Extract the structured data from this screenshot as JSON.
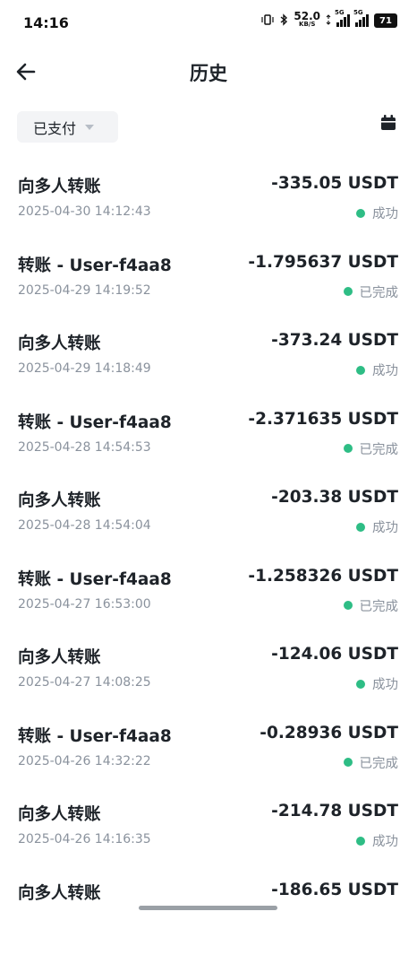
{
  "status_bar": {
    "time": "14:16",
    "net_speed": "52.0",
    "net_unit": "KB/S",
    "signal1_tag": "5G",
    "signal2_tag": "5G",
    "battery": "71"
  },
  "header": {
    "title": "历史"
  },
  "filter": {
    "label": "已支付"
  },
  "transactions": [
    {
      "name": "向多人转账",
      "amount": "-335.05 USDT",
      "date": "2025-04-30 14:12:43",
      "status": "成功"
    },
    {
      "name": "转账 - User-f4aa8",
      "amount": "-1.795637 USDT",
      "date": "2025-04-29 14:19:52",
      "status": "已完成"
    },
    {
      "name": "向多人转账",
      "amount": "-373.24 USDT",
      "date": "2025-04-29 14:18:49",
      "status": "成功"
    },
    {
      "name": "转账 - User-f4aa8",
      "amount": "-2.371635 USDT",
      "date": "2025-04-28 14:54:53",
      "status": "已完成"
    },
    {
      "name": "向多人转账",
      "amount": "-203.38 USDT",
      "date": "2025-04-28 14:54:04",
      "status": "成功"
    },
    {
      "name": "转账 - User-f4aa8",
      "amount": "-1.258326 USDT",
      "date": "2025-04-27 16:53:00",
      "status": "已完成"
    },
    {
      "name": "向多人转账",
      "amount": "-124.06 USDT",
      "date": "2025-04-27 14:08:25",
      "status": "成功"
    },
    {
      "name": "转账 - User-f4aa8",
      "amount": "-0.28936 USDT",
      "date": "2025-04-26 14:32:22",
      "status": "已完成"
    },
    {
      "name": "向多人转账",
      "amount": "-214.78 USDT",
      "date": "2025-04-26 14:16:35",
      "status": "成功"
    },
    {
      "name": "向多人转账",
      "amount": "-186.65 USDT",
      "date": "",
      "status": ""
    }
  ],
  "colors": {
    "success_dot": "#2ebd85",
    "text_primary": "#1e2329",
    "text_secondary": "#8a929d"
  }
}
